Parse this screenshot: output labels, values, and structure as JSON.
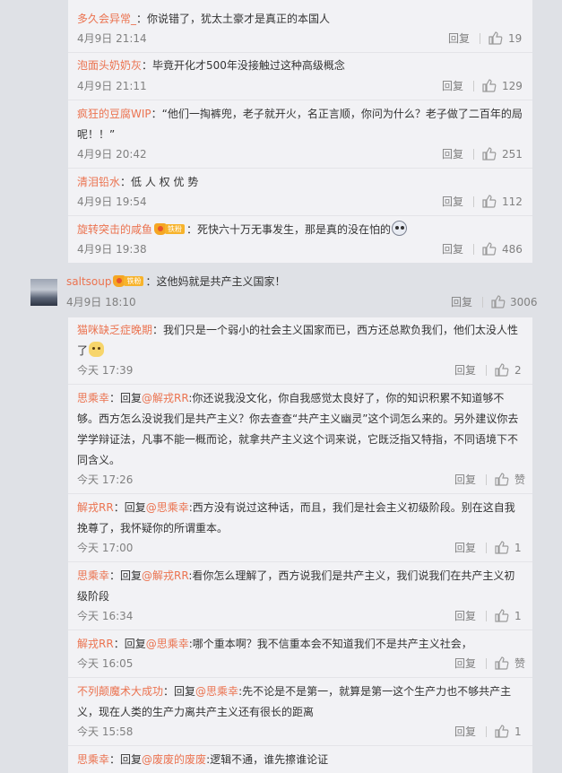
{
  "colors": {
    "accent": "#eb7350",
    "muted": "#808080",
    "panel": "#f2f2f5",
    "background": "#dfe1e6"
  },
  "icons": {
    "like": "thumbs-up-icon",
    "badge": "fan-badge-icon",
    "emoji1": "ghost-emoji-icon",
    "emoji2": "cat-emoji-icon"
  },
  "reply_label": "回复",
  "top_group": [
    {
      "user": "多久会异常_",
      "sep": "：",
      "text": "你说错了，犹太土豪才是真正的本国人",
      "time": "4月9日 21:14",
      "likes": "19"
    },
    {
      "user": "泡面头奶奶灰",
      "sep": "：",
      "text": "毕竟开化才500年没接触过这种高级概念",
      "time": "4月9日 21:11",
      "likes": "129"
    },
    {
      "user": "疯狂的豆腐WIP",
      "sep": "：",
      "text": "“他们一掏裤兜，老子就开火，名正言顺，你问为什么？老子做了二百年的局",
      "text2": "呢！！”",
      "time": "4月9日 20:42",
      "likes": "251"
    },
    {
      "user": "清泪铅水",
      "sep": "：",
      "text": "低 人 权 优 势",
      "time": "4月9日 19:54",
      "likes": "112"
    },
    {
      "user": "旋转突击的咸鱼",
      "badge": "铁粉",
      "sep": "：",
      "text": "死快六十万无事发生，那是真的没在怕的",
      "time": "4月9日 19:38",
      "likes": "486"
    }
  ],
  "main": {
    "user": "saltsoup",
    "badge": "铁粉",
    "sep": "：",
    "text": "这他妈就是共产主义国家！",
    "time": "4月9日 18:10",
    "likes": "3006"
  },
  "replies": [
    {
      "user": "猫咪缺乏症晚期",
      "sep": "：",
      "text": "我们只是一个弱小的社会主义国家而已，西方还总欺负我们，他们太没人性",
      "text2": "了",
      "time": "今天 17:39",
      "likes": "2"
    },
    {
      "user": "思乘幸",
      "sep": "：",
      "prefix": "回复",
      "at": "@解戎RR",
      "colon": ":",
      "text": "你还说我没文化，你自我感觉太良好了，你的知识积累不知道够不",
      "text2": "够。西方怎么没说我们是共产主义？你去查查“共产主义幽灵”这个词怎么来的。另外建议你去",
      "text3": "学学辩证法，凡事不能一概而论，就拿共产主义这个词来说，它既泛指又特指，不同语境下不",
      "text4": "同含义。",
      "time": "今天 17:26",
      "likes": "赞"
    },
    {
      "user": "解戎RR",
      "sep": "：",
      "prefix": "回复",
      "at": "@思乘幸",
      "colon": ":",
      "text": "西方没有说过这种话，而且，我们是社会主义初级阶段。别在这自我",
      "text2": "挽尊了，我怀疑你的所谓重本。",
      "time": "今天 17:00",
      "likes": "1"
    },
    {
      "user": "思乘幸",
      "sep": "：",
      "prefix": "回复",
      "at": "@解戎RR",
      "colon": ":",
      "text": "看你怎么理解了，西方说我们是共产主义，我们说我们在共产主义初",
      "text2": "级阶段",
      "time": "今天 16:34",
      "likes": "1"
    },
    {
      "user": "解戎RR",
      "sep": "：",
      "prefix": "回复",
      "at": "@思乘幸",
      "colon": ":",
      "text": "哪个重本啊？我不信重本会不知道我们不是共产主义社会，",
      "time": "今天 16:05",
      "likes": "赞"
    },
    {
      "user": "不列颠魔术大成功",
      "sep": "：",
      "prefix": "回复",
      "at": "@思乘幸",
      "colon": ":",
      "text": "先不论是不是第一，就算是第一这个生产力也不够共产主",
      "text2": "义，现在人类的生产力离共产主义还有很长的距离",
      "time": "今天 15:58",
      "likes": "1"
    },
    {
      "user": "思乘幸",
      "sep": "：",
      "prefix": "回复",
      "at": "@废废的废废",
      "colon": ":",
      "text": "逻辑不通，谁先擦谁论证"
    }
  ]
}
